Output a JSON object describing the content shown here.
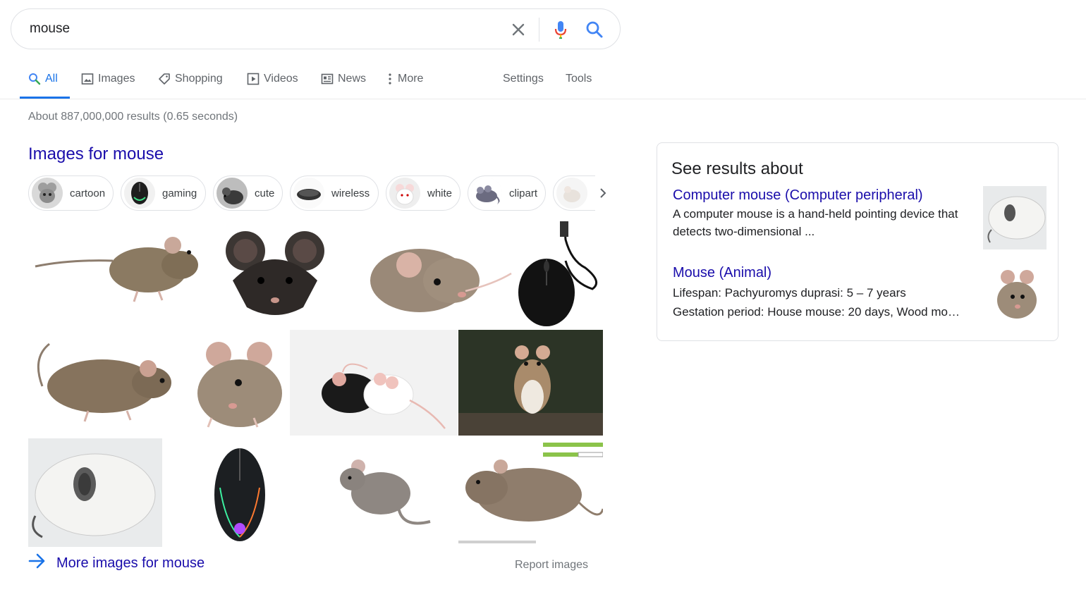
{
  "search": {
    "query": "mouse"
  },
  "tabs": [
    {
      "label": "All",
      "icon": "search-icon"
    },
    {
      "label": "Images",
      "icon": "image-icon"
    },
    {
      "label": "Shopping",
      "icon": "tag-icon"
    },
    {
      "label": "Videos",
      "icon": "play-icon"
    },
    {
      "label": "News",
      "icon": "newspaper-icon"
    },
    {
      "label": "More",
      "icon": "vertical-dots-icon"
    },
    {
      "label": "Settings"
    },
    {
      "label": "Tools"
    }
  ],
  "stats": "About 887,000,000 results (0.65 seconds)",
  "images": {
    "heading": "Images for mouse",
    "chips": [
      "cartoon",
      "gaming",
      "cute",
      "wireless",
      "white",
      "clipart"
    ],
    "more_label": "More images for mouse",
    "report_label": "Report images"
  },
  "panel": {
    "title": "See results about",
    "results": [
      {
        "title": "Computer mouse (Computer peripheral)",
        "text": "A computer mouse is a hand-held pointing device that detects two-dimensional ..."
      },
      {
        "title": "Mouse (Animal)",
        "line1": "Lifespan: Pachyuromys duprasi: 5 – 7 years",
        "line2": "Gestation period: House mouse: 20 days, Wood mo…"
      }
    ]
  },
  "colors": {
    "link": "#1a0dab",
    "accent": "#1a73e8",
    "muted": "#70757a"
  }
}
